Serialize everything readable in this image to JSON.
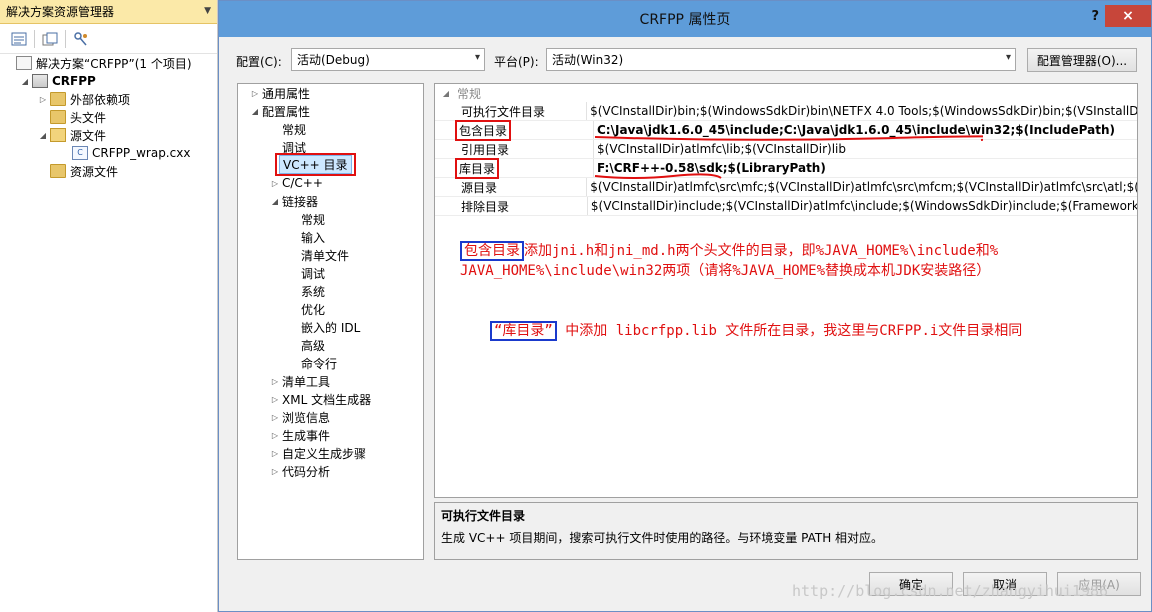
{
  "solution_explorer": {
    "title": "解决方案资源管理器",
    "solution_label": "解决方案“CRFPP”(1 个项目)",
    "project": "CRFPP",
    "nodes": {
      "external_deps": "外部依赖项",
      "headers": "头文件",
      "sources": "源文件",
      "source_file": "CRFPP_wrap.cxx",
      "resources": "资源文件"
    }
  },
  "dialog": {
    "title": "CRFPP 属性页",
    "help": "?",
    "close": "×",
    "config_label": "配置(C):",
    "config_value": "活动(Debug)",
    "platform_label": "平台(P):",
    "platform_value": "活动(Win32)",
    "config_manager": "配置管理器(O)..."
  },
  "left_tree": {
    "general_props": "通用属性",
    "config_props": "配置属性",
    "normal": "常规",
    "debug": "调试",
    "vc_dirs": "VC++ 目录",
    "cpp": "C/C++",
    "linker": "链接器",
    "linker_children": [
      "常规",
      "输入",
      "清单文件",
      "调试",
      "系统",
      "优化",
      "嵌入的 IDL",
      "高级",
      "命令行"
    ],
    "tail": [
      "清单工具",
      "XML 文档生成器",
      "浏览信息",
      "生成事件",
      "自定义生成步骤",
      "代码分析"
    ]
  },
  "grid": {
    "category": "常规",
    "rows": [
      {
        "name": "可执行文件目录",
        "value": "$(VCInstallDir)bin;$(WindowsSdkDir)bin\\NETFX 4.0 Tools;$(WindowsSdkDir)bin;$(VSInstallDir)Co"
      },
      {
        "name": "包含目录",
        "value": "C:\\Java\\jdk1.6.0_45\\include;C:\\Java\\jdk1.6.0_45\\include\\win32;$(IncludePath)"
      },
      {
        "name": "引用目录",
        "value": "$(VCInstallDir)atlmfc\\lib;$(VCInstallDir)lib"
      },
      {
        "name": "库目录",
        "value": "F:\\CRF++-0.58\\sdk;$(LibraryPath)"
      },
      {
        "name": "源目录",
        "value": "$(VCInstallDir)atlmfc\\src\\mfc;$(VCInstallDir)atlmfc\\src\\mfcm;$(VCInstallDir)atlmfc\\src\\atl;$(VCIn"
      },
      {
        "name": "排除目录",
        "value": "$(VCInstallDir)include;$(VCInstallDir)atlmfc\\include;$(WindowsSdkDir)include;$(FrameworkSDK"
      }
    ]
  },
  "description": {
    "title": "可执行文件目录",
    "text": "生成 VC++ 项目期间，搜索可执行文件时使用的路径。与环境变量 PATH 相对应。"
  },
  "annotations": {
    "a1_box": "包含目录",
    "a1_line1": "添加jni.h和jni_md.h两个头文件的目录，即%JAVA_HOME%\\include和%",
    "a1_line2": "JAVA_HOME%\\include\\win32两项（请将%JAVA_HOME%替换成本机JDK安装路径）",
    "a2_box": "“库目录”",
    "a2_text": "中添加 libcrfpp.lib 文件所在目录，我这里与CRFPP.i文件目录相同"
  },
  "buttons": {
    "ok": "确定",
    "cancel": "取消",
    "apply": "应用(A)"
  },
  "watermark": "http://blog.csdn.net/zhangyihui1986",
  "colors": {
    "annotation_red": "#e01010",
    "annotation_blue": "#1a3acc",
    "title_bar": "#5e9cd9",
    "solution_header": "#fbe9a8"
  }
}
